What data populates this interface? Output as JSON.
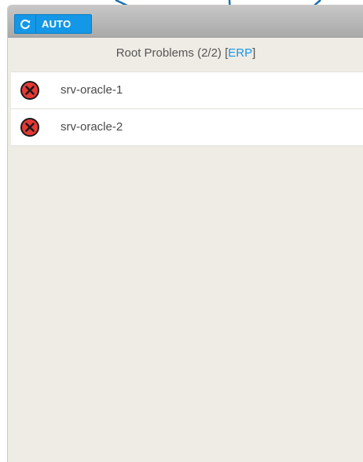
{
  "toolbar": {
    "refresh_icon": "refresh-icon",
    "auto_label": "AUTO",
    "accent_color": "#1497e6"
  },
  "header": {
    "title": "Root Problems (2/2)",
    "bracket_open": "[",
    "link_label": "ERP",
    "bracket_close": "]"
  },
  "problems": [
    {
      "icon": "error-x-icon",
      "name": "srv-oracle-1",
      "status_color": "#e53935"
    },
    {
      "icon": "error-x-icon",
      "name": "srv-oracle-2",
      "status_color": "#e53935"
    }
  ]
}
